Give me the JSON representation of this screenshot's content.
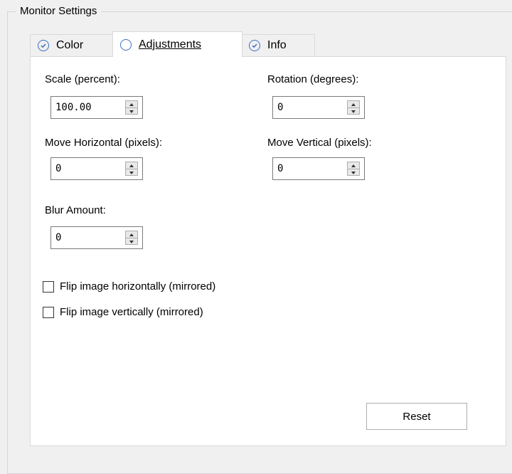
{
  "group": {
    "title": "Monitor Settings"
  },
  "tabs": [
    {
      "label": "Color",
      "icon": "check-circle-icon"
    },
    {
      "label": "Adjustments",
      "icon": "empty-circle-icon",
      "active": true
    },
    {
      "label": "Info",
      "icon": "check-circle-icon"
    }
  ],
  "fields": {
    "scale": {
      "label": "Scale (percent):",
      "value": "100.00"
    },
    "rotation": {
      "label": "Rotation (degrees):",
      "value": "0"
    },
    "move_h": {
      "label": "Move Horizontal (pixels):",
      "value": "0"
    },
    "move_v": {
      "label": "Move Vertical (pixels):",
      "value": "0"
    },
    "blur": {
      "label": "Blur Amount:",
      "value": "0"
    }
  },
  "checkboxes": {
    "flip_h": {
      "label": "Flip image horizontally (mirrored)",
      "checked": false
    },
    "flip_v": {
      "label": "Flip image vertically (mirrored)",
      "checked": false
    }
  },
  "buttons": {
    "reset": "Reset"
  },
  "colors": {
    "accent": "#3a6fc4",
    "panel": "#ffffff",
    "background": "#f0f0f0"
  }
}
